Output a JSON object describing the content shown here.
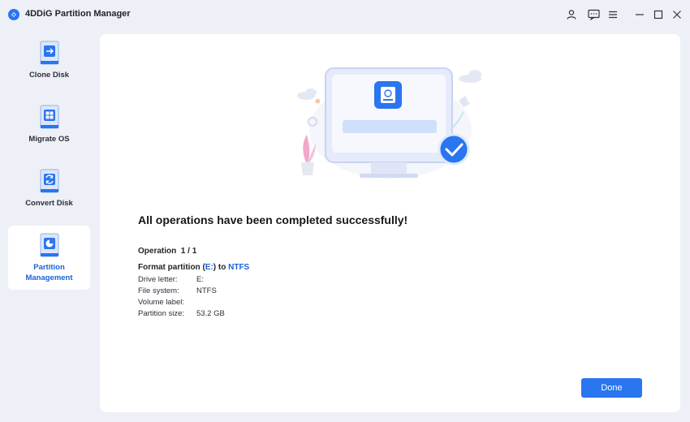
{
  "window": {
    "title": "4DDiG Partition Manager",
    "controls": [
      "user-icon",
      "feedback-icon",
      "menu-icon",
      "minimize-icon",
      "maximize-icon",
      "close-icon"
    ]
  },
  "sidebar": {
    "items": [
      {
        "label": "Clone Disk",
        "icon": "clone-disk-icon"
      },
      {
        "label": "Migrate OS",
        "icon": "migrate-os-icon"
      },
      {
        "label": "Convert Disk",
        "icon": "convert-disk-icon"
      },
      {
        "label": "Partition Management",
        "icon": "partition-management-icon",
        "active": true
      }
    ]
  },
  "main": {
    "title": "All operations have been completed successfully!",
    "operation": {
      "label": "Operation",
      "count": "1 / 1",
      "desc_prefix": "Format partition (",
      "drive": "E:",
      "desc_middle": ") to ",
      "fs": "NTFS"
    },
    "details": [
      {
        "label": "Drive letter:",
        "value": "E:"
      },
      {
        "label": "File system:",
        "value": "NTFS"
      },
      {
        "label": "Volume label:",
        "value": ""
      },
      {
        "label": "Partition size:",
        "value": "53.2 GB"
      }
    ],
    "done_label": "Done"
  },
  "colors": {
    "accent": "#2a75f0",
    "highlight_text": "#1a62d6",
    "background": "#eef0f7",
    "panel": "#ffffff"
  }
}
